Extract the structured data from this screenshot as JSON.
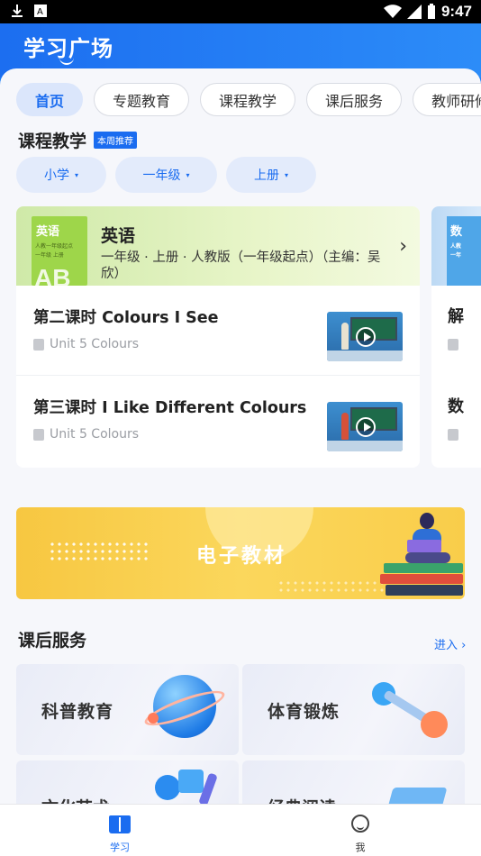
{
  "status_bar": {
    "time": "9:47"
  },
  "header": {
    "title": "学习广场"
  },
  "tabs": [
    {
      "label": "首页",
      "active": true
    },
    {
      "label": "专题教育",
      "active": false
    },
    {
      "label": "课程教学",
      "active": false
    },
    {
      "label": "课后服务",
      "active": false
    },
    {
      "label": "教师研修",
      "active": false
    }
  ],
  "course_section": {
    "title": "课程教学",
    "badge": "本周推荐",
    "filters": [
      "小学",
      "一年级",
      "上册"
    ]
  },
  "course_card": {
    "cover": {
      "title": "英语",
      "line1": "人教一年级起点",
      "line2": "一年级 上册",
      "letters": "AB"
    },
    "subject": "英语",
    "meta": "一年级 · 上册 · 人教版（一年级起点）（主编：吴欣）",
    "lessons": [
      {
        "title": "第二课时 Colours I See",
        "unit": "Unit 5 Colours"
      },
      {
        "title": "第三课时 I Like Different Colours",
        "unit": "Unit 5 Colours"
      }
    ]
  },
  "peek_card": {
    "cover_title": "数",
    "cover_line1": "人教",
    "cover_line2": "一年",
    "lesson1_prefix": "解",
    "lesson2_prefix": "数"
  },
  "banner": {
    "title": "电子教材"
  },
  "after_school": {
    "title": "课后服务",
    "more": "进入 ›",
    "items": [
      {
        "label": "科普教育"
      },
      {
        "label": "体育锻炼"
      },
      {
        "label": "文化艺术"
      },
      {
        "label": "经典阅读"
      }
    ]
  },
  "bottom_nav": [
    {
      "label": "学习",
      "active": true
    },
    {
      "label": "我",
      "active": false
    }
  ],
  "colors": {
    "primary": "#1a6cf0",
    "header": "#1c6ef0",
    "banner": "#f7c741"
  }
}
